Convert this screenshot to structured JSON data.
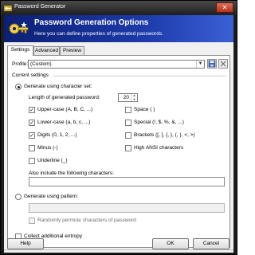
{
  "window": {
    "title": "Password Generator",
    "close_glyph": "✕"
  },
  "banner": {
    "title": "Password Generation Options",
    "subtitle": "Here you can define properties of generated passwords."
  },
  "tabs": [
    {
      "label": "Settings",
      "active": true
    },
    {
      "label": "Advanced",
      "active": false
    },
    {
      "label": "Preview",
      "active": false
    }
  ],
  "profile": {
    "label": "Profile:",
    "value": "(Custom)",
    "save_icon": "save-icon",
    "delete_icon": "delete-icon"
  },
  "current_settings": {
    "label": "Current settings",
    "charset_radio_label": "Generate using character set:",
    "length_label": "Length of generated password:",
    "length_value": "20",
    "options_left": [
      {
        "label": "Upper-case (A, B, C, ...)",
        "checked": true
      },
      {
        "label": "Lower-case (a, b, c, ...)",
        "checked": true
      },
      {
        "label": "Digits (0, 1, 2, ...)",
        "checked": true
      },
      {
        "label": "Minus (-)",
        "checked": false
      },
      {
        "label": "Underline (_)",
        "checked": false
      }
    ],
    "options_right": [
      {
        "label": "Space ( )",
        "checked": false
      },
      {
        "label": "Special (!, $, %, &, ...)",
        "checked": false
      },
      {
        "label": "Brackets ([, ], {, }, (, ), <, >)",
        "checked": false
      },
      {
        "label": "High ANSI characters",
        "checked": false
      }
    ],
    "also_include_label": "Also include the following characters:",
    "also_include_value": "",
    "pattern_radio_label": "Generate using pattern:",
    "pattern_value": "",
    "permute_label": "Randomly permute characters of password",
    "entropy_label": "Collect additional entropy",
    "check_glyph": "✓"
  },
  "buttons": {
    "help": "Help",
    "ok": "OK",
    "cancel": "Cancel"
  }
}
